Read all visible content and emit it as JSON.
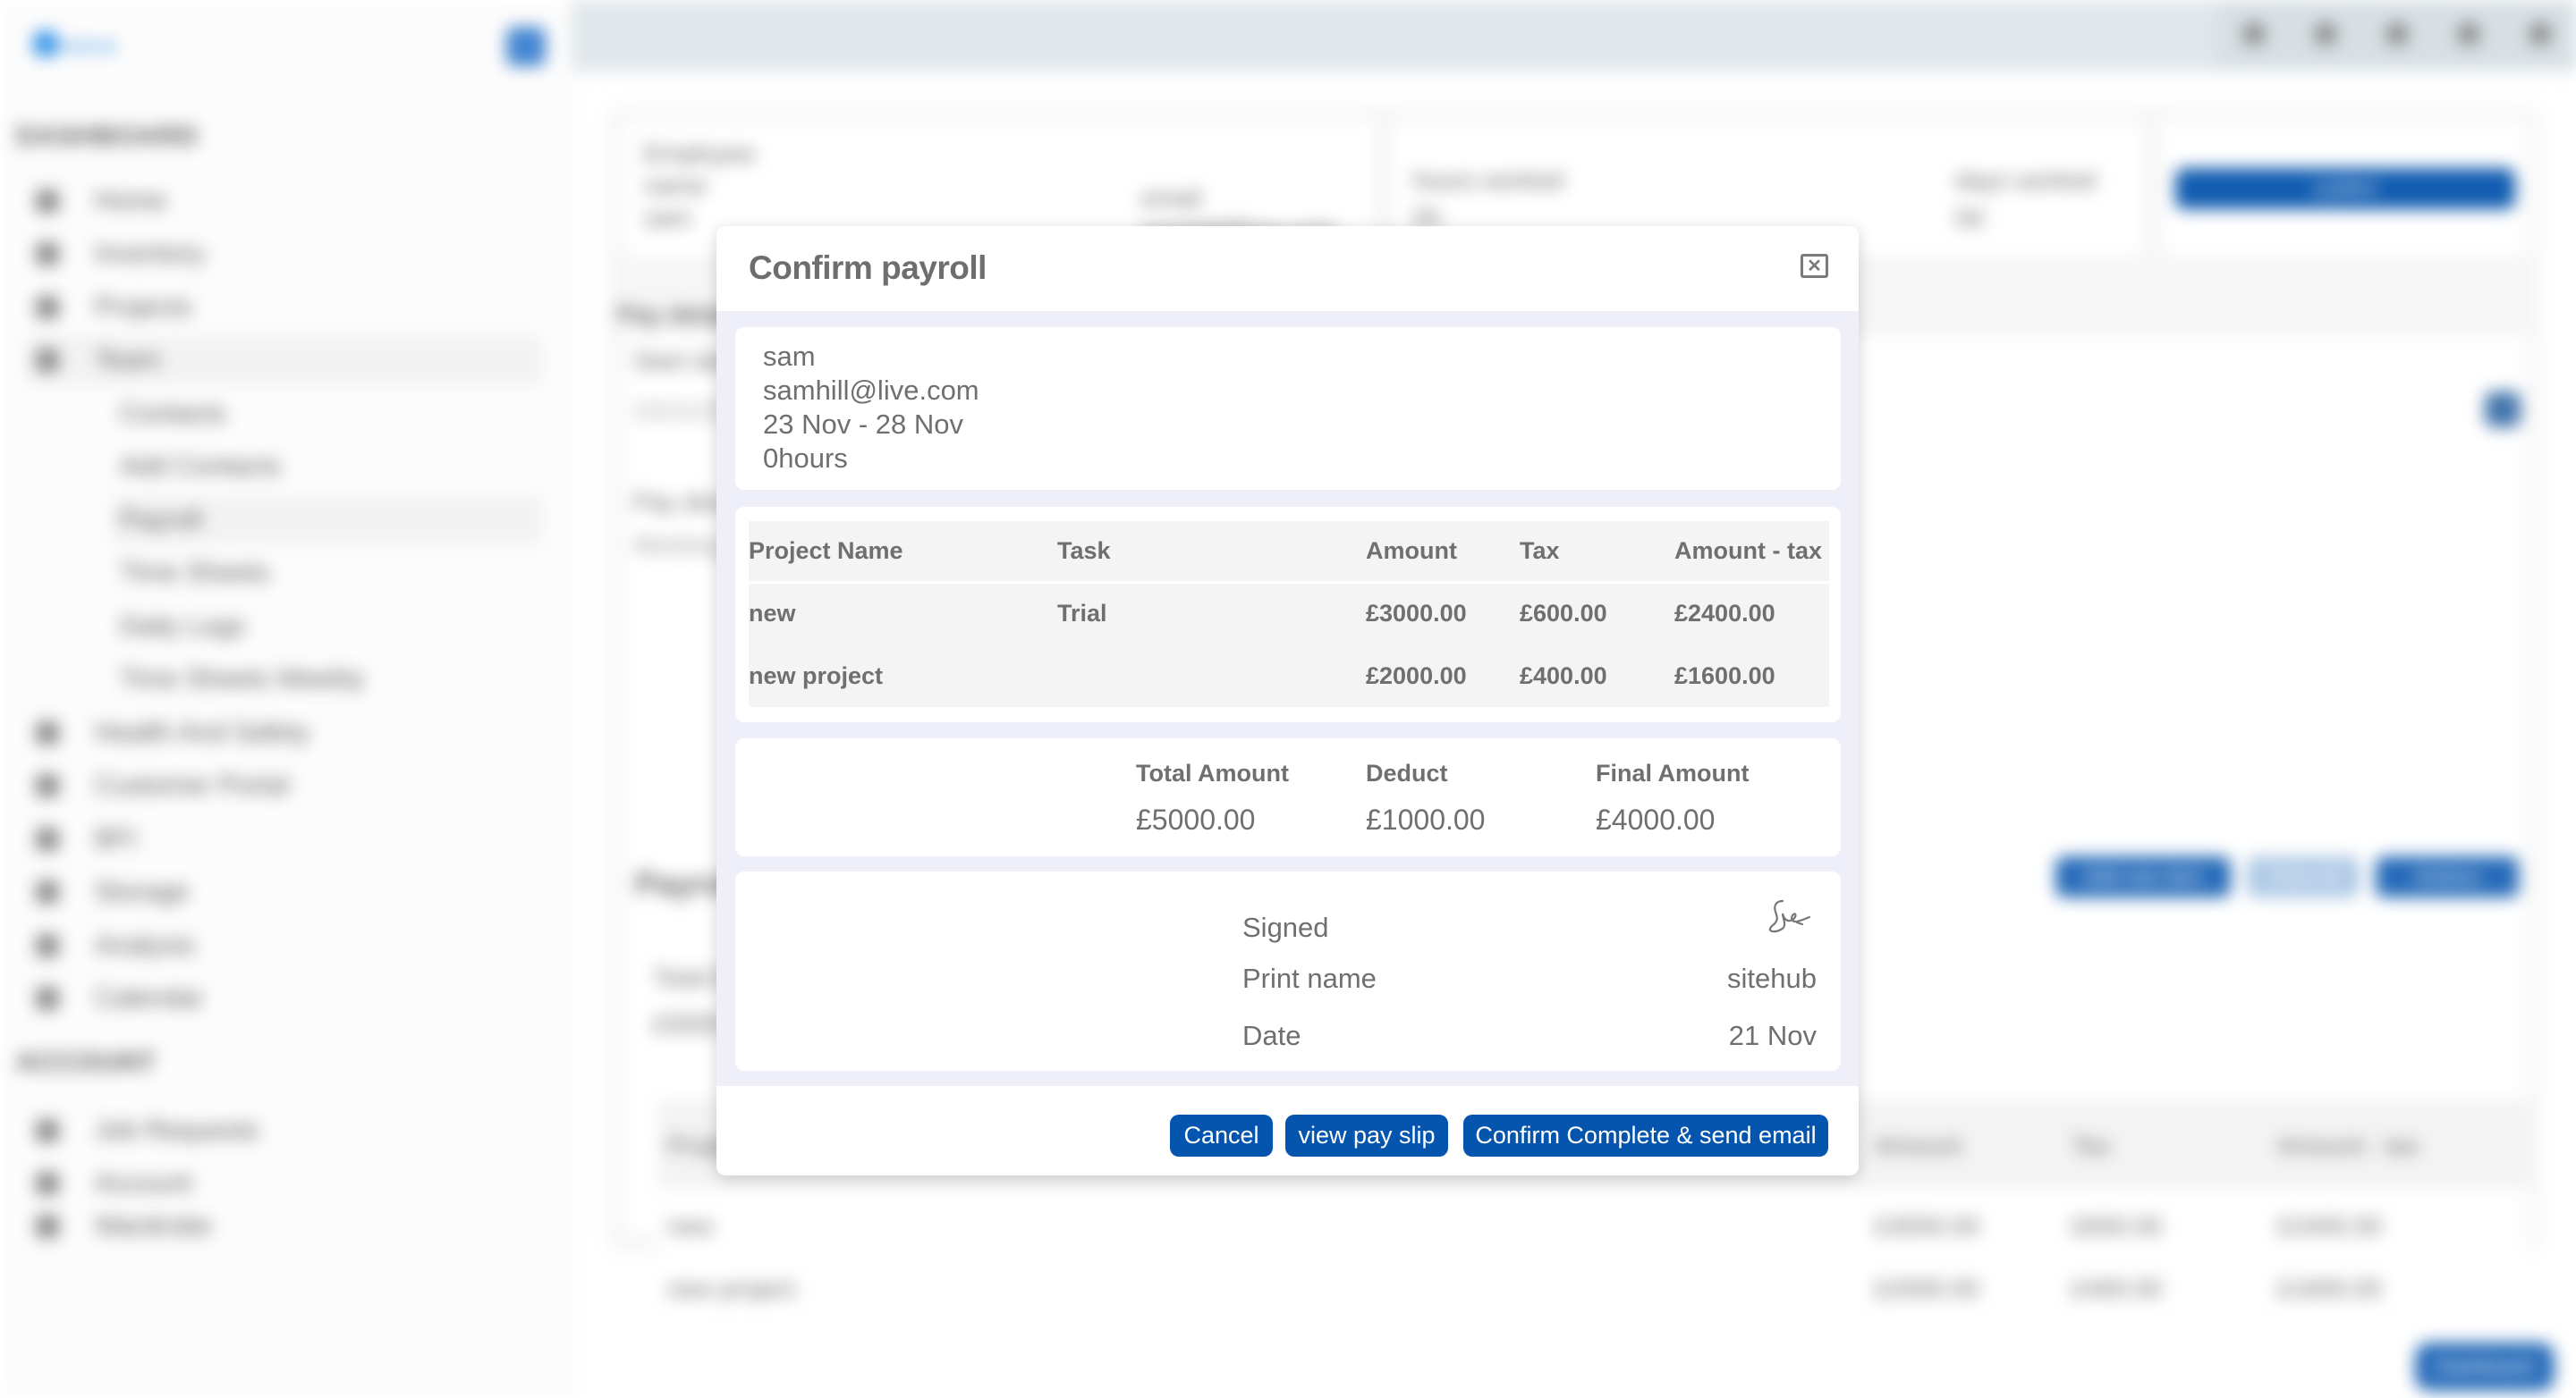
{
  "background": {
    "logo_text": "sitehub",
    "sidebar": {
      "section_dashboard": "DASHBOARD",
      "items": [
        {
          "label": "Home",
          "icon": "home-icon"
        },
        {
          "label": "Inventory",
          "icon": "inventory-icon"
        },
        {
          "label": "Projects",
          "icon": "filter-icon"
        },
        {
          "label": "Team",
          "icon": "team-icon",
          "active": true
        }
      ],
      "sub_items": [
        {
          "label": "Contacts"
        },
        {
          "label": "Add Contacts"
        },
        {
          "label": "Payroll",
          "active": true
        },
        {
          "label": "Time Sheets"
        },
        {
          "label": "Daily Logs"
        },
        {
          "label": "Time Sheets Weekly"
        }
      ],
      "more_items": [
        {
          "label": "Health And Safety",
          "icon": "health-icon"
        },
        {
          "label": "Customer Portal",
          "icon": "portal-icon"
        },
        {
          "label": "BFI",
          "icon": "bfi-icon"
        },
        {
          "label": "Storage",
          "icon": "storage-icon"
        },
        {
          "label": "Analysis",
          "icon": "analysis-icon"
        },
        {
          "label": "Calendar",
          "icon": "calendar-icon"
        }
      ],
      "section_account": "ACCOUNT",
      "account_items": [
        {
          "label": "Job Requests",
          "icon": "job-icon"
        },
        {
          "label": "Account",
          "icon": "account-icon"
        },
        {
          "label": "Wardrobe",
          "icon": "wardrobe-icon"
        }
      ]
    },
    "employee_card": {
      "employee_label": "Employee",
      "name_label": "name",
      "name_value": "sam",
      "email_label": "email",
      "email_value": "samhill@live.com"
    },
    "hours_card": {
      "hours_label": "hours worked",
      "hours_value": "0h",
      "days_label": "days worked",
      "days_value": "0d"
    },
    "confirm_button": "confirm",
    "pay_details_title": "Pay details",
    "start_label": "Start date",
    "start_value": "23/11/2023",
    "pay_desc_label": "Pay description",
    "pay_desc_value": "Working",
    "payroll_title": "Payroll",
    "payroll_buttons": [
      "Add new item",
      "Clear all",
      "Actions"
    ],
    "total_label": "Total Amount",
    "total_value": "£5000.00",
    "table_headers": [
      "Project Name",
      "Task",
      "Amount",
      "Tax",
      "Amount - tax"
    ],
    "table_rows": [
      [
        "new",
        "Trial",
        "£3000.00",
        "£600.00",
        "£2400.00"
      ],
      [
        "new project",
        "",
        "£2000.00",
        "£400.00",
        "£1600.00"
      ]
    ],
    "fab_label": "Dashboard"
  },
  "modal": {
    "title": "Confirm payroll",
    "close_icon": "close-icon",
    "employee": {
      "name": "sam",
      "email": "samhill@live.com",
      "period": "23 Nov - 28 Nov",
      "hours": "0hours"
    },
    "table": {
      "headers": [
        "Project Name",
        "Task",
        "Amount",
        "Tax",
        "Amount - tax"
      ],
      "rows": [
        [
          "new",
          "Trial",
          "£3000.00",
          "£600.00",
          "£2400.00"
        ],
        [
          "new project",
          "",
          "£2000.00",
          "£400.00",
          "£1600.00"
        ]
      ]
    },
    "totals": {
      "total_label": "Total Amount",
      "total_value": "£5000.00",
      "deduct_label": "Deduct",
      "deduct_value": "£1000.00",
      "final_label": "Final Amount",
      "final_value": "£4000.00"
    },
    "signature": {
      "signed_label": "Signed",
      "print_name_label": "Print name",
      "print_name_value": "sitehub",
      "date_label": "Date",
      "date_value": "21 Nov"
    },
    "buttons": {
      "cancel": "Cancel",
      "view_pay_slip": "view pay slip",
      "confirm": "Confirm Complete & send email"
    }
  },
  "colors": {
    "primary": "#0554ad",
    "modal_bg": "#efeff9",
    "text": "#6f6f6f"
  }
}
